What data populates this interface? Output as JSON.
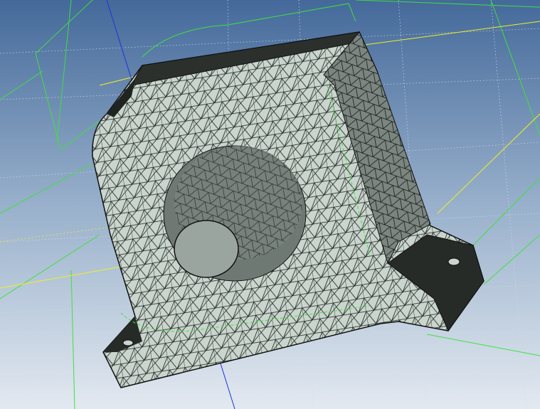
{
  "viewport": {
    "background_top": "#4a6f9c",
    "background_bottom": "#dfe6ee",
    "mesh_fill": "#c9d5cd",
    "mesh_edge": "#1a1f1c",
    "dark_face": "#2b302d",
    "edge_green": "#3fe03f",
    "axis_yellow": "#f0f020",
    "axis_blue": "#2030e0",
    "grid_dot": "#c8d4e4"
  }
}
